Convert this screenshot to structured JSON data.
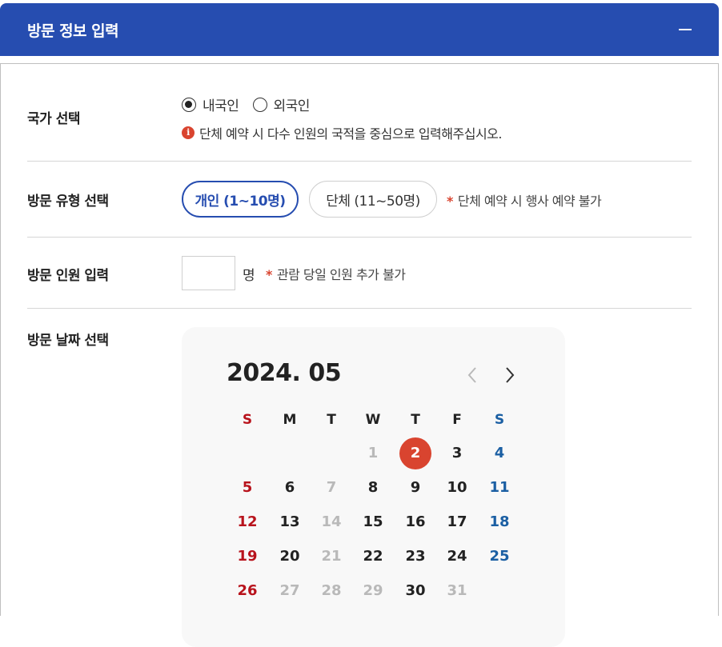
{
  "header": {
    "title": "방문 정보 입력",
    "collapse_icon": "minus-icon"
  },
  "country": {
    "label": "국가 선택",
    "options": [
      {
        "label": "내국인",
        "checked": true
      },
      {
        "label": "외국인",
        "checked": false
      }
    ],
    "note_icon": "info-icon",
    "note_icon_glyph": "i",
    "note": "단체 예약 시 다수 인원의 국적을 중심으로 입력해주십시오."
  },
  "visit_type": {
    "label": "방문 유형 선택",
    "options": [
      {
        "label": "개인 (1~10명)",
        "active": true
      },
      {
        "label": "단체 (11~50명)",
        "active": false
      }
    ],
    "warning_star": "*",
    "warning": "단체 예약 시 행사 예약 불가"
  },
  "visitors": {
    "label": "방문 인원 입력",
    "value": "",
    "unit": "명",
    "warning_star": "*",
    "warning": "관람 당일 인원 추가 불가"
  },
  "date": {
    "label": "방문 날짜 선택",
    "calendar": {
      "month_title": "2024. 05",
      "prev_icon": "chevron-left-icon",
      "next_icon": "chevron-right-icon",
      "weekdays": [
        "S",
        "M",
        "T",
        "W",
        "T",
        "F",
        "S"
      ],
      "selected_day": "2",
      "weeks": [
        [
          "",
          "",
          "",
          "1",
          "2",
          "3",
          "4"
        ],
        [
          "5",
          "6",
          "7",
          "8",
          "9",
          "10",
          "11"
        ],
        [
          "12",
          "13",
          "14",
          "15",
          "16",
          "17",
          "18"
        ],
        [
          "19",
          "20",
          "21",
          "22",
          "23",
          "24",
          "25"
        ],
        [
          "26",
          "27",
          "28",
          "29",
          "30",
          "31",
          ""
        ]
      ],
      "disabled_days": [
        "1",
        "7",
        "14",
        "21",
        "27",
        "28",
        "29",
        "31"
      ]
    }
  },
  "colors": {
    "primary": "#264db0",
    "accent_red": "#d9442f",
    "sunday": "#b8131c",
    "saturday": "#1b5fa3",
    "disabled": "#b9b9b9"
  }
}
